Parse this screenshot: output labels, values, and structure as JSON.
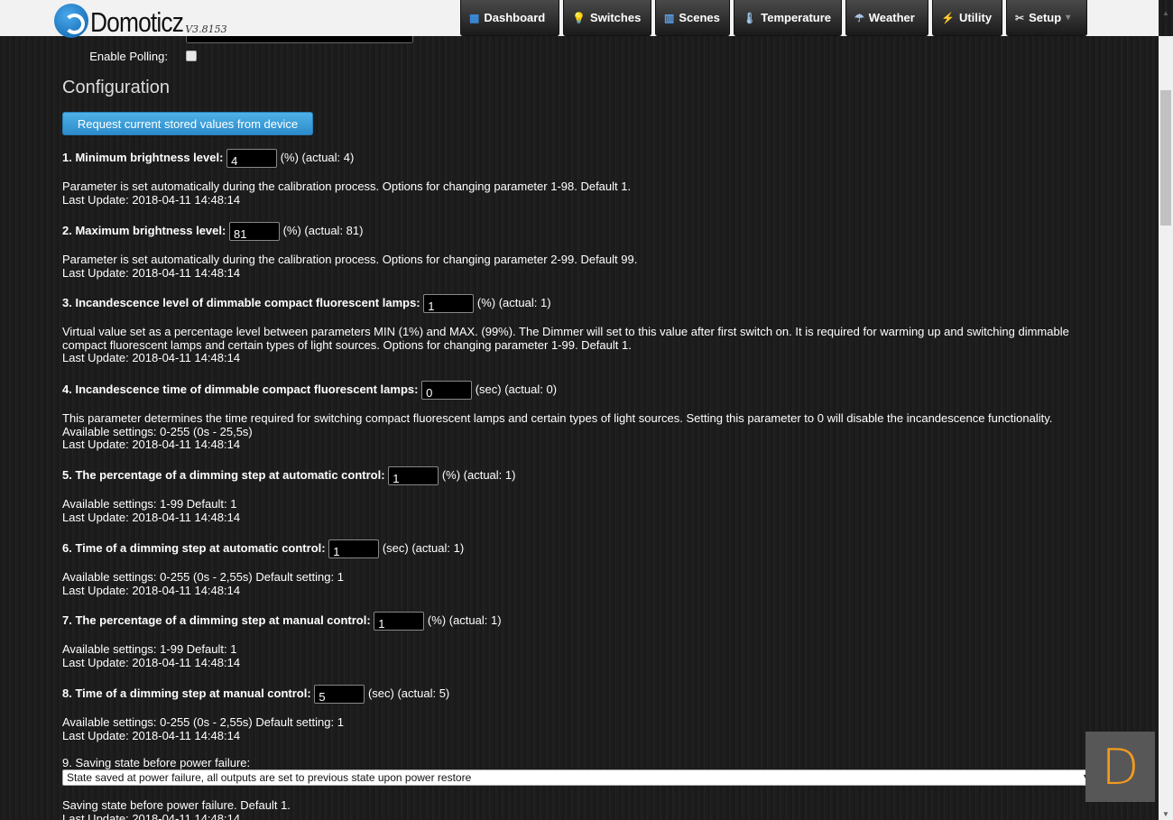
{
  "header": {
    "app_name": "Domoticz",
    "version": "V3.8153",
    "nav": [
      {
        "label": "Dashboard",
        "icon": "dashboard-icon",
        "glyph": "▦"
      },
      {
        "label": "Switches",
        "icon": "lightbulb-icon",
        "glyph": "💡"
      },
      {
        "label": "Scenes",
        "icon": "scenes-icon",
        "glyph": "▥"
      },
      {
        "label": "Temperature",
        "icon": "thermometer-icon",
        "glyph": "🌡"
      },
      {
        "label": "Weather",
        "icon": "weather-icon",
        "glyph": "☂"
      },
      {
        "label": "Utility",
        "icon": "utility-icon",
        "glyph": "⚡"
      },
      {
        "label": "Setup",
        "icon": "tools-icon",
        "glyph": "✂"
      }
    ],
    "setup_caret": "▾"
  },
  "polling": {
    "label": "Enable Polling:",
    "checked": false
  },
  "config": {
    "title": "Configuration",
    "request_button": "Request current stored values from device",
    "params": [
      {
        "label": "1. Minimum brightness level:",
        "value": "4",
        "suffix": "(%) (actual: 4)",
        "desc": [
          "Parameter is set automatically during the calibration process. Options for changing parameter 1-98. Default 1."
        ],
        "last_update": "Last Update: 2018-04-11 14:48:14"
      },
      {
        "label": "2. Maximum brightness level:",
        "value": "81",
        "suffix": "(%) (actual: 81)",
        "desc": [
          "Parameter is set automatically during the calibration process. Options for changing parameter 2-99. Default 99."
        ],
        "last_update": "Last Update: 2018-04-11 14:48:14"
      },
      {
        "label": "3. Incandescence level of dimmable compact fluorescent lamps:",
        "value": "1",
        "suffix": "(%) (actual: 1)",
        "desc": [
          "Virtual value set as a percentage level between parameters MIN (1%) and MAX. (99%). The Dimmer will set to this value after first switch on. It is required for warming up and switching dimmable",
          "compact fluorescent lamps and certain types of light sources. Options for changing parameter 1-99. Default 1."
        ],
        "last_update": "Last Update: 2018-04-11 14:48:14"
      },
      {
        "label": "4. Incandescence time of dimmable compact fluorescent lamps:",
        "value": "0",
        "suffix": "(sec) (actual: 0)",
        "desc": [
          "This parameter determines the time required for switching compact fluorescent lamps and certain types of light sources. Setting this parameter to 0 will disable the incandescence functionality.",
          "Available settings: 0-255 (0s - 25,5s)"
        ],
        "last_update": "Last Update: 2018-04-11 14:48:14"
      },
      {
        "label": "5. The percentage of a dimming step at automatic control:",
        "value": "1",
        "suffix": "(%) (actual: 1)",
        "desc": [
          "Available settings: 1-99 Default: 1"
        ],
        "last_update": "Last Update: 2018-04-11 14:48:14"
      },
      {
        "label": "6. Time of a dimming step at automatic control:",
        "value": "1",
        "suffix": "(sec) (actual: 1)",
        "desc": [
          "Available settings: 0-255 (0s - 2,55s) Default setting: 1"
        ],
        "last_update": "Last Update: 2018-04-11 14:48:14"
      },
      {
        "label": "7. The percentage of a dimming step at manual control:",
        "value": "1",
        "suffix": "(%) (actual: 1)",
        "desc": [
          "Available settings: 1-99 Default: 1"
        ],
        "last_update": "Last Update: 2018-04-11 14:48:14"
      },
      {
        "label": "8. Time of a dimming step at manual control:",
        "value": "5",
        "suffix": "(sec) (actual: 5)",
        "desc": [
          "Available settings: 0-255 (0s - 2,55s) Default setting: 1"
        ],
        "last_update": "Last Update: 2018-04-11 14:48:14"
      }
    ],
    "param9": {
      "label": "9. Saving state before power failure:",
      "selected": "State saved at power failure, all outputs are set to previous state upon power restore",
      "desc": "Saving state before power failure. Default 1.",
      "last_update": "Last Update: 2018-04-11 14:48:14"
    }
  },
  "brand_badge": {
    "letter": "D",
    "color": "#f29b1d"
  }
}
